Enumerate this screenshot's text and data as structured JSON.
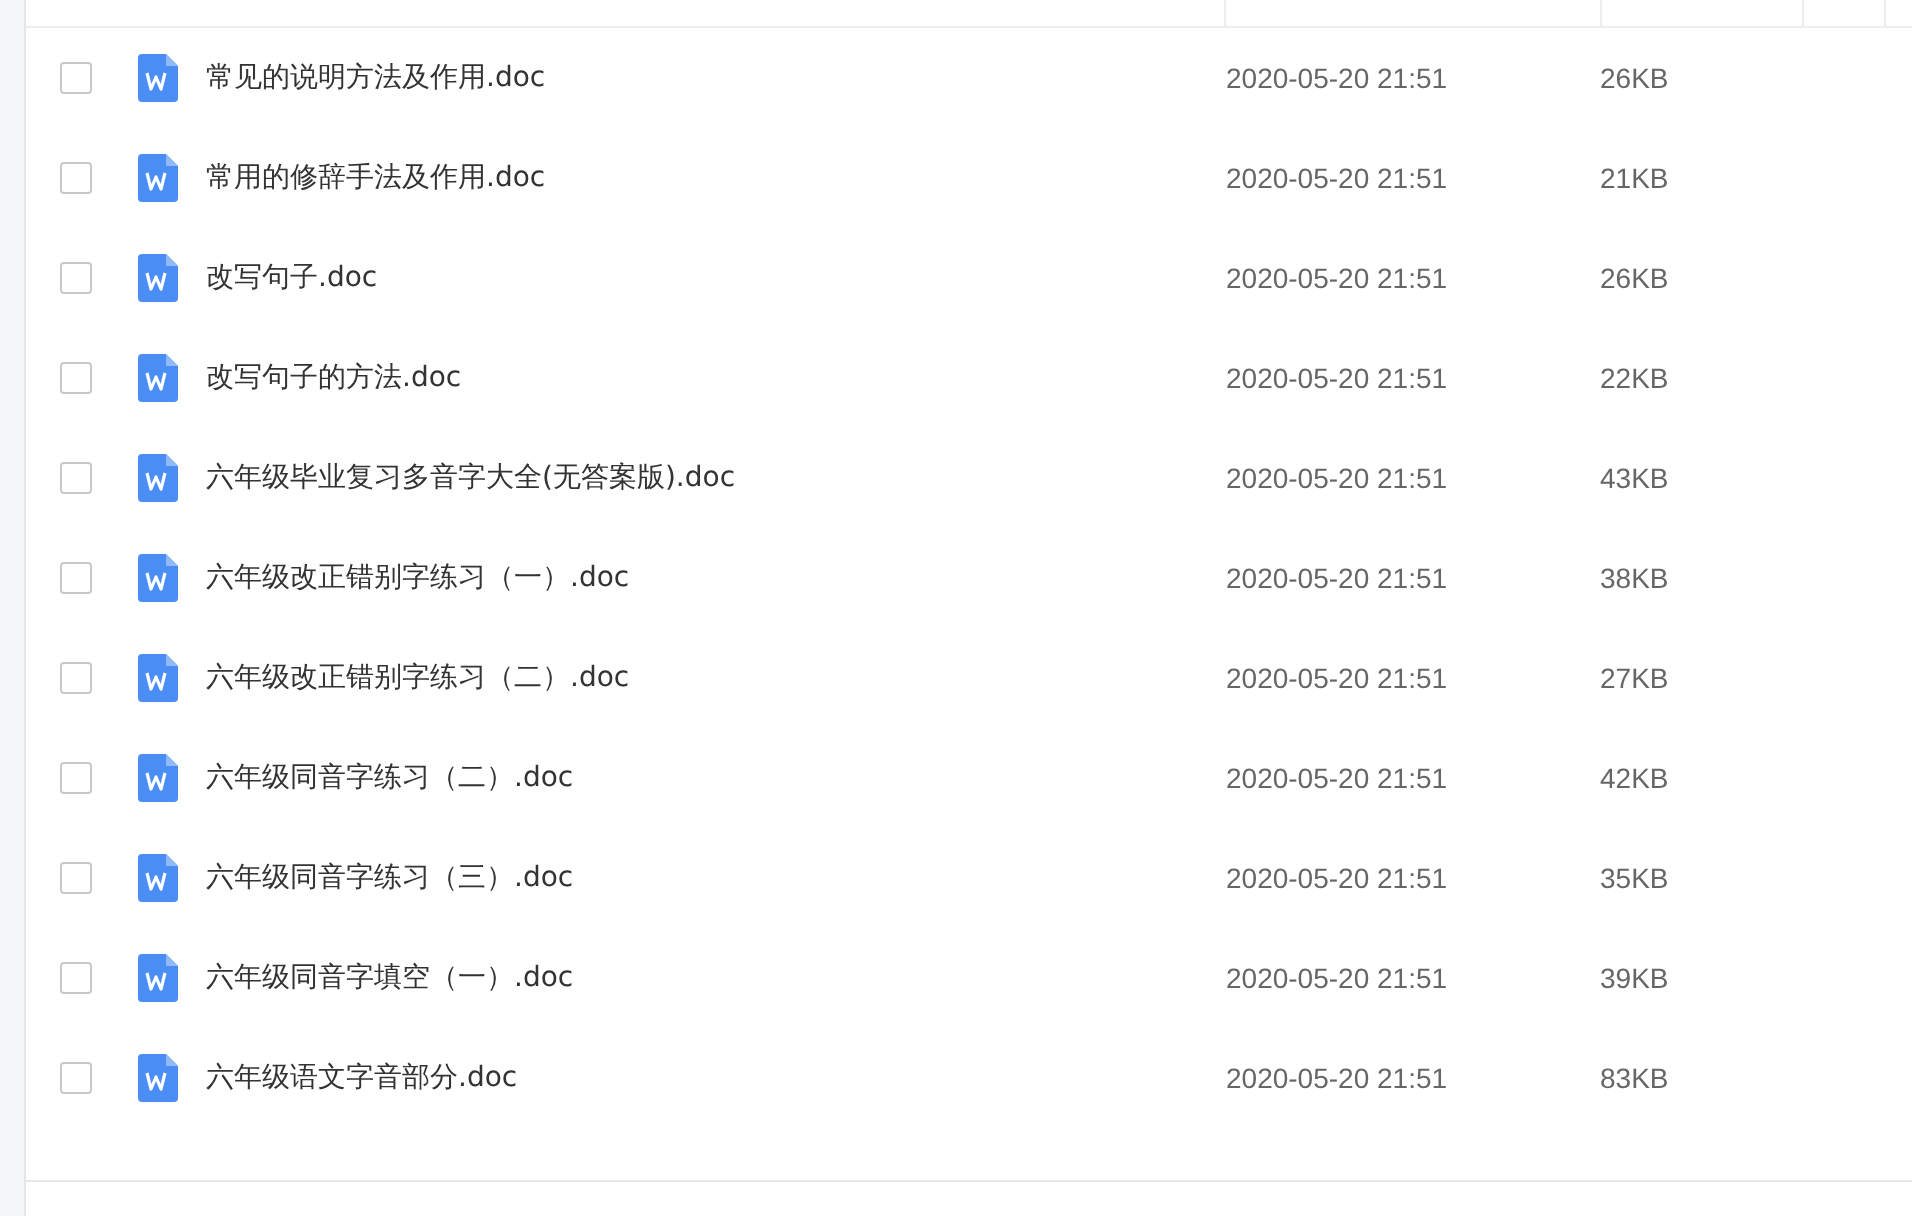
{
  "files": [
    {
      "name": "常见的说明方法及作用.doc",
      "modified": "2020-05-20 21:51",
      "size": "26KB",
      "checked": false
    },
    {
      "name": "常用的修辞手法及作用.doc",
      "modified": "2020-05-20 21:51",
      "size": "21KB",
      "checked": false
    },
    {
      "name": "改写句子.doc",
      "modified": "2020-05-20 21:51",
      "size": "26KB",
      "checked": false
    },
    {
      "name": "改写句子的方法.doc",
      "modified": "2020-05-20 21:51",
      "size": "22KB",
      "checked": false
    },
    {
      "name": "六年级毕业复习多音字大全(无答案版).doc",
      "modified": "2020-05-20 21:51",
      "size": "43KB",
      "checked": false
    },
    {
      "name": "六年级改正错别字练习（一）.doc",
      "modified": "2020-05-20 21:51",
      "size": "38KB",
      "checked": false
    },
    {
      "name": "六年级改正错别字练习（二）.doc",
      "modified": "2020-05-20 21:51",
      "size": "27KB",
      "checked": false
    },
    {
      "name": "六年级同音字练习（二）.doc",
      "modified": "2020-05-20 21:51",
      "size": "42KB",
      "checked": false
    },
    {
      "name": "六年级同音字练习（三）.doc",
      "modified": "2020-05-20 21:51",
      "size": "35KB",
      "checked": false
    },
    {
      "name": "六年级同音字填空（一）.doc",
      "modified": "2020-05-20 21:51",
      "size": "39KB",
      "checked": false
    },
    {
      "name": "六年级语文字音部分.doc",
      "modified": "2020-05-20 21:51",
      "size": "83KB",
      "checked": false
    }
  ]
}
